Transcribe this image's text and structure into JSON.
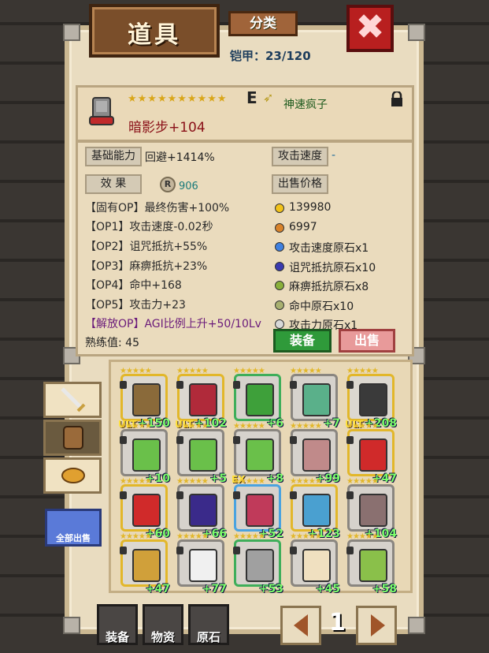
{
  "header": {
    "title": "道具",
    "category_button": "分类",
    "armor_count": "铠甲：23/120",
    "close_label": "✖"
  },
  "item": {
    "stars": "★★★★★★★★★★",
    "grade": "E",
    "title_name": "神速疯子",
    "name": "暗影步+104"
  },
  "stats": {
    "base_ability_label": "基础能力",
    "base_ability_value": "回避+1414%",
    "attack_speed_label": "攻击速度",
    "attack_speed_value": "-",
    "effect_label": "效 果",
    "effect_value": "906",
    "sell_price_label": "出售价格",
    "options": [
      "【固有OP】最终伤害+100%",
      "【OP1】攻击速度-0.02秒",
      "【OP2】诅咒抵抗+55%",
      "【OP3】麻痹抵抗+23%",
      "【OP4】命中+168",
      "【OP5】攻击力+23"
    ],
    "unlock_op": "【解放OP】AGI比例上升+50/10Lv",
    "proficiency": "熟练值: 45",
    "prices": [
      {
        "text": "139980",
        "color": "#f2c21a"
      },
      {
        "text": "6997",
        "color": "#d9832a"
      },
      {
        "text": "攻击速度原石x1",
        "color": "#3f80e0"
      },
      {
        "text": "诅咒抵抗原石x10",
        "color": "#3a3ab0"
      },
      {
        "text": "麻痹抵抗原石x8",
        "color": "#8ab03a"
      },
      {
        "text": "命中原石x10",
        "color": "#a8b070"
      },
      {
        "text": "攻击力原石x1",
        "color": "#d8d8d8"
      }
    ]
  },
  "buttons": {
    "equip": "装备",
    "sell": "出售",
    "sell_all": "全部出售"
  },
  "grid": [
    {
      "plus": "+150",
      "ult": "ULT",
      "color": "#8a6a3a",
      "border": "gold"
    },
    {
      "plus": "+102",
      "ult": "ULT",
      "color": "#b02a3a",
      "border": "gold"
    },
    {
      "plus": "+6",
      "ult": "",
      "color": "#3ea03a",
      "border": "green"
    },
    {
      "plus": "+7",
      "ult": "",
      "color": "#5ab08a",
      "border": "gray"
    },
    {
      "plus": "+208",
      "ult": "ULT",
      "color": "#3a3a3a",
      "border": "gold"
    },
    {
      "plus": "+10",
      "ult": "",
      "color": "#6ac04a",
      "border": "gray"
    },
    {
      "plus": "+5",
      "ult": "",
      "color": "#6ac04a",
      "border": "gray"
    },
    {
      "plus": "+8",
      "ult": "EX",
      "color": "#6ac04a",
      "border": "gray"
    },
    {
      "plus": "+99",
      "ult": "",
      "color": "#c08a8a",
      "border": "gray"
    },
    {
      "plus": "+47",
      "ult": "",
      "color": "#d02a2a",
      "border": "gold"
    },
    {
      "plus": "+60",
      "ult": "",
      "color": "#d02a2a",
      "border": "gold"
    },
    {
      "plus": "+66",
      "ult": "",
      "color": "#3a2a8a",
      "border": "gray"
    },
    {
      "plus": "+52",
      "ult": "",
      "color": "#c03a5a",
      "border": "blue"
    },
    {
      "plus": "+123",
      "ult": "",
      "color": "#4aa0d0",
      "border": "gold"
    },
    {
      "plus": "+104",
      "ult": "",
      "color": "#8a7070",
      "border": "gray"
    },
    {
      "plus": "+47",
      "ult": "",
      "color": "#d0a03a",
      "border": "gold"
    },
    {
      "plus": "+77",
      "ult": "",
      "color": "#f0f0f0",
      "border": "gray"
    },
    {
      "plus": "+53",
      "ult": "",
      "color": "#a0a0a0",
      "border": "green"
    },
    {
      "plus": "+45",
      "ult": "",
      "color": "#f0e0c0",
      "border": "gray"
    },
    {
      "plus": "+58",
      "ult": "",
      "color": "#8ac04a",
      "border": "gray"
    }
  ],
  "footer": {
    "tab_equip": "装备",
    "tab_material": "物资",
    "tab_stone": "原石",
    "page": "1"
  }
}
